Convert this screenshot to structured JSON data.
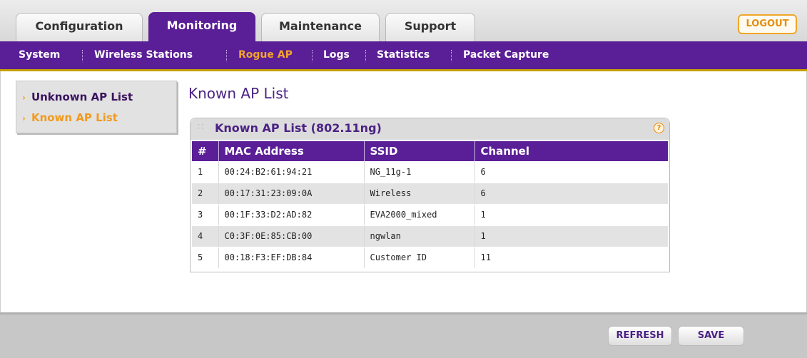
{
  "tabs": [
    {
      "label": "Configuration"
    },
    {
      "label": "Monitoring"
    },
    {
      "label": "Maintenance"
    },
    {
      "label": "Support"
    }
  ],
  "logout_label": "LOGOUT",
  "subnav": [
    {
      "label": "System"
    },
    {
      "label": "Wireless Stations"
    },
    {
      "label": "Rogue AP"
    },
    {
      "label": "Logs"
    },
    {
      "label": "Statistics"
    },
    {
      "label": "Packet Capture"
    }
  ],
  "side_menu": [
    {
      "label": "Unknown AP List"
    },
    {
      "label": "Known AP List"
    }
  ],
  "page_title": "Known AP List",
  "panel": {
    "title": "Known AP List (802.11ng)",
    "help_glyph": "?",
    "columns": [
      "#",
      "MAC Address",
      "SSID",
      "Channel"
    ],
    "rows": [
      [
        "1",
        "00:24:B2:61:94:21",
        "NG_11g-1",
        "6"
      ],
      [
        "2",
        "00:17:31:23:09:0A",
        "Wireless",
        "6"
      ],
      [
        "3",
        "00:1F:33:D2:AD:82",
        "EVA2000_mixed",
        "1"
      ],
      [
        "4",
        "C0:3F:0E:85:CB:00",
        "ngwlan",
        "1"
      ],
      [
        "5",
        "00:18:F3:EF:DB:84",
        "Customer ID",
        "11"
      ]
    ]
  },
  "buttons": {
    "refresh": "REFRESH",
    "save": "SAVE"
  },
  "colors": {
    "brand_purple": "#5a1e96",
    "accent_orange": "#f19a1d",
    "gold_rule": "#c6a000"
  }
}
